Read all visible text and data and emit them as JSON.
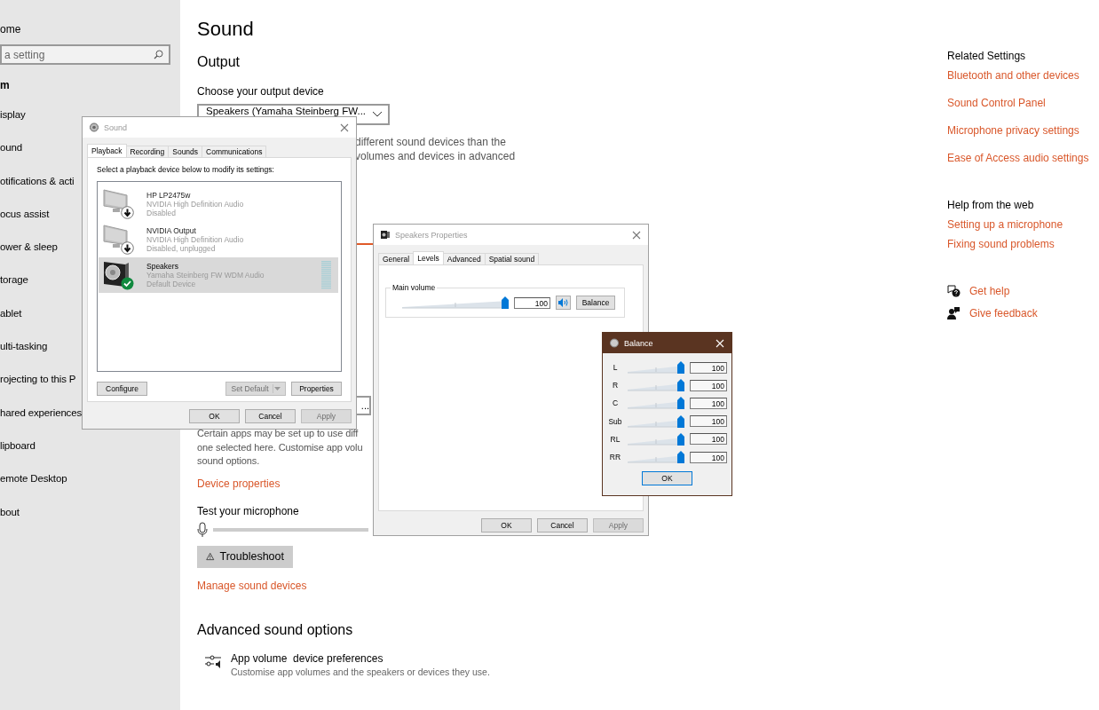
{
  "settings": {
    "sidebar": {
      "home": "ome",
      "search": {
        "placeholder": "a setting"
      },
      "section": "m",
      "items": [
        "isplay",
        "ound",
        "otifications & acti",
        "ocus assist",
        "ower & sleep",
        "torage",
        "ablet",
        "ulti-tasking",
        "rojecting to this P",
        "hared experiences",
        "lipboard",
        "emote Desktop",
        "bout"
      ]
    },
    "main": {
      "title": "Sound",
      "output_heading": "Output",
      "output_label": "Choose your output device",
      "output_device": "Speakers (Yamaha Steinberg FW...",
      "output_note_lines": [
        "different sound devices than the",
        "volumes and devices in advanced"
      ],
      "input_device": "...",
      "app_note_lines": [
        "Certain apps may be set up to use diff",
        "one selected here. Customise app volu",
        "sound options."
      ],
      "device_properties_link": "Device properties",
      "test_label": "Test your microphone",
      "troubleshoot_button": "Troubleshoot",
      "manage_link": "Manage sound devices",
      "advanced_heading": "Advanced sound options",
      "app_volume": {
        "title": "App volume  device preferences",
        "subtitle": "Customise app volumes and the speakers or devices they use."
      }
    },
    "related": {
      "heading": "Related Settings",
      "links": [
        "Bluetooth and other devices",
        "Sound Control Panel",
        "Microphone privacy settings",
        "Ease of Access audio settings"
      ],
      "help_heading": "Help from the web",
      "help_links": [
        "Setting up a microphone",
        "Fixing sound problems"
      ],
      "get_help": "Get help",
      "give_feedback": "Give feedback"
    }
  },
  "sound_dialog": {
    "title": "Sound",
    "active": false,
    "tabs": [
      {
        "label": "Playback",
        "selected": true
      },
      {
        "label": "Recording",
        "selected": false
      },
      {
        "label": "Sounds",
        "selected": false
      },
      {
        "label": "Communications",
        "selected": false
      }
    ],
    "instruction": "Select a playback device below to modify its settings:",
    "devices": [
      {
        "kind": "monitor",
        "disabled": true,
        "default": false,
        "name": "HP LP2475w",
        "driver": "NVIDIA High Definition Audio",
        "status": "Disabled",
        "selected": false
      },
      {
        "kind": "monitor",
        "disabled": true,
        "default": false,
        "name": "NVIDIA Output",
        "driver": "NVIDIA High Definition Audio",
        "status": "Disabled, unplugged",
        "selected": false
      },
      {
        "kind": "speaker",
        "disabled": false,
        "default": true,
        "name": "Speakers",
        "driver": "Yamaha Steinberg FW WDM Audio",
        "status": "Default Device",
        "selected": true
      }
    ],
    "panel_buttons": [
      {
        "label": "Configure",
        "disabled": false,
        "kind": "plain"
      },
      {
        "label": "Set Default",
        "disabled": true,
        "kind": "split"
      },
      {
        "label": "Properties",
        "disabled": false,
        "kind": "plain"
      }
    ],
    "buttons": [
      {
        "label": "OK",
        "disabled": false
      },
      {
        "label": "Cancel",
        "disabled": false
      },
      {
        "label": "Apply",
        "disabled": true
      }
    ]
  },
  "properties_dialog": {
    "title": "Speakers Properties",
    "active": false,
    "tabs": [
      {
        "label": "General",
        "selected": false
      },
      {
        "label": "Levels",
        "selected": true
      },
      {
        "label": "Advanced",
        "selected": false
      },
      {
        "label": "Spatial sound",
        "selected": false
      }
    ],
    "main_volume": {
      "label": "Main volume",
      "level": 1,
      "value": "100",
      "balance_button": "Balance"
    },
    "buttons": [
      {
        "label": "OK",
        "disabled": false
      },
      {
        "label": "Cancel",
        "disabled": false
      },
      {
        "label": "Apply",
        "disabled": true
      }
    ]
  },
  "balance_dialog": {
    "title": "Balance",
    "active": true,
    "channels": [
      {
        "label": "L",
        "level": 1,
        "value": "100"
      },
      {
        "label": "R",
        "level": 1,
        "value": "100"
      },
      {
        "label": "C",
        "level": 1,
        "value": "100"
      },
      {
        "label": "Sub",
        "level": 1,
        "value": "100"
      },
      {
        "label": "RL",
        "level": 1,
        "value": "100"
      },
      {
        "label": "RR",
        "level": 1,
        "value": "100"
      }
    ],
    "ok_button": "OK"
  }
}
